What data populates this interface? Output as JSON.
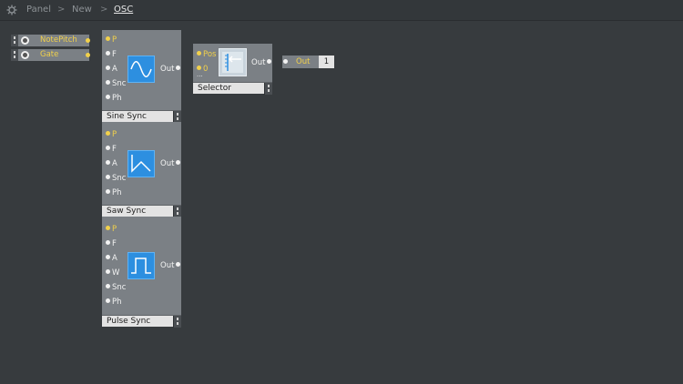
{
  "breadcrumb": {
    "items": [
      "Panel",
      "New",
      "OSC"
    ],
    "separator": ">"
  },
  "inputs": [
    {
      "label": "NotePitch"
    },
    {
      "label": "Gate"
    }
  ],
  "modules": {
    "sine": {
      "name": "Sine Sync",
      "ports": [
        "P",
        "F",
        "A",
        "Snc",
        "Ph"
      ],
      "out": "Out",
      "icon": "sine-wave-icon"
    },
    "saw": {
      "name": "Saw Sync",
      "ports": [
        "P",
        "F",
        "A",
        "Snc",
        "Ph"
      ],
      "out": "Out",
      "icon": "saw-wave-icon"
    },
    "pulse": {
      "name": "Pulse Sync",
      "ports": [
        "P",
        "F",
        "A",
        "W",
        "Snc",
        "Ph"
      ],
      "out": "Out",
      "icon": "pulse-wave-icon"
    },
    "selector": {
      "name": "Selector",
      "ports": [
        "Pos",
        "0"
      ],
      "out": "Out",
      "icon": "selector-icon",
      "extra": "..."
    }
  },
  "output": {
    "label": "Out",
    "channel": "1"
  },
  "colors": {
    "background": "#373b3e",
    "module": "#7b8085",
    "accent_yellow": "#f1d04b",
    "icon_blue": "#2d8fe0"
  }
}
